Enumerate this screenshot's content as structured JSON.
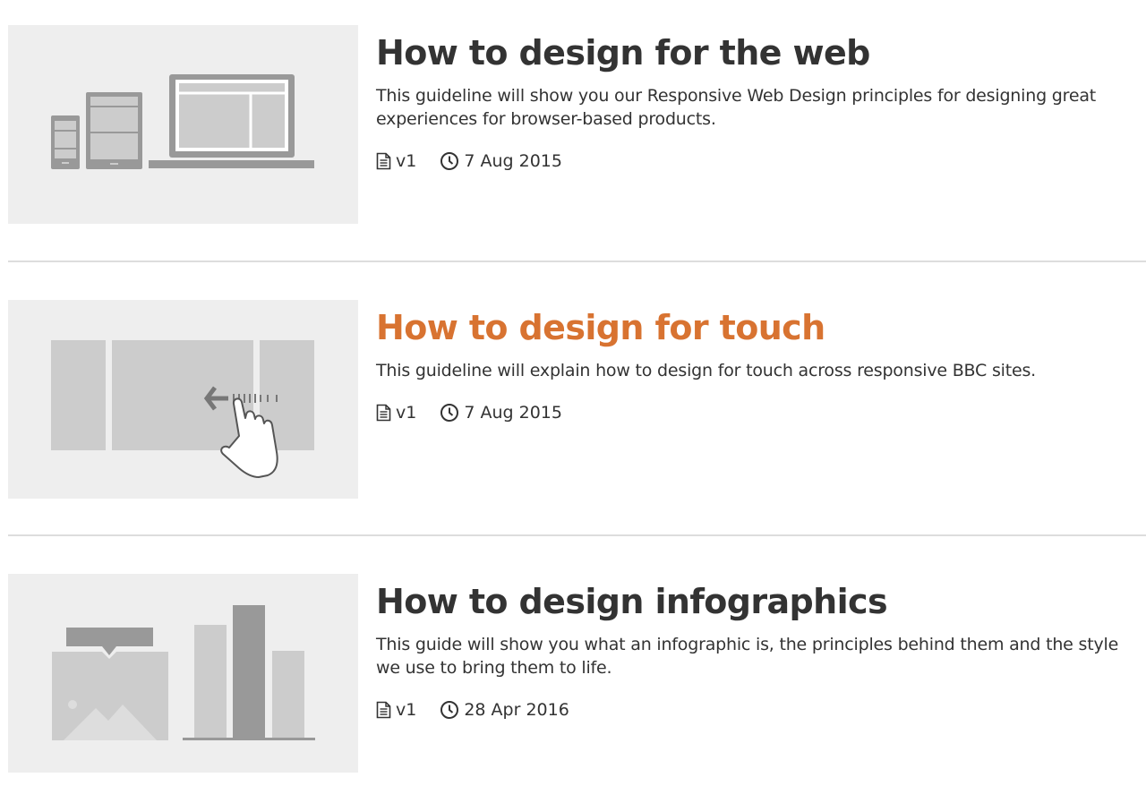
{
  "guides": [
    {
      "title": "How to design for the web",
      "description": "This guideline will show you our Responsive Web Design principles for designing great experiences for browser-based products.",
      "version": "v1",
      "date": "7 Aug 2015",
      "illustration": "devices-illustration"
    },
    {
      "title": "How to design for touch",
      "description": "This guideline will explain how to design for touch across responsive BBC sites.",
      "version": "v1",
      "date": "7 Aug 2015",
      "illustration": "swipe-gesture-illustration"
    },
    {
      "title": "How to design infographics",
      "description": "This guide will show you what an infographic is, the principles behind them and the style we use to bring them to life.",
      "version": "v1",
      "date": "28 Apr 2016",
      "illustration": "infographic-illustration"
    }
  ],
  "colors": {
    "text": "#333333",
    "hover_title": "#d87331",
    "thumbnail_bg": "#eeeeee",
    "divider": "#dddddd",
    "illustration_light": "#cccccc",
    "illustration_dark": "#999999"
  },
  "icons": {
    "version": "document-icon",
    "date": "clock-icon"
  }
}
